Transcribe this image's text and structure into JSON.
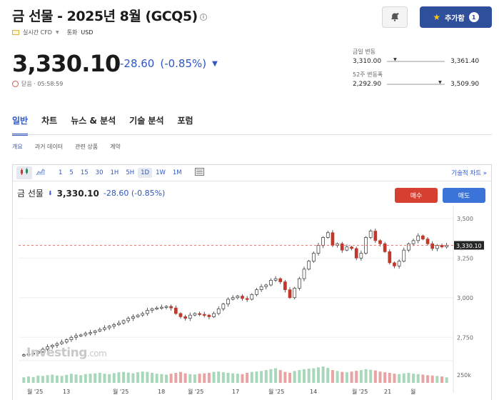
{
  "header": {
    "title": "금 선물 - 2025년 8월 (GCQ5)",
    "info_glyph": "i",
    "realtime_label": "실시간 CFD",
    "currency_label": "통화",
    "currency_value": "USD",
    "add_button_label": "추가함",
    "add_button_count": "1"
  },
  "quote": {
    "price": "3,330.10",
    "change": "-28.60",
    "change_pct": "(-0.85%)",
    "status": "닫음 · 05:58:59"
  },
  "ranges": {
    "daily_label": "금일 변동",
    "daily_low": "3,310.00",
    "daily_high": "3,361.40",
    "week52_label": "52주 변동폭",
    "week52_low": "2,292.90",
    "week52_high": "3,509.90"
  },
  "tabs": [
    "일반",
    "차트",
    "뉴스 & 분석",
    "기술 분석",
    "포럼"
  ],
  "subtabs": [
    "개요",
    "과거 데이터",
    "관련 상품",
    "계약"
  ],
  "toolbar": {
    "intervals": [
      "1",
      "5",
      "15",
      "30",
      "1H",
      "5H",
      "1D",
      "1W",
      "1M"
    ],
    "active": "1D",
    "tech_chart": "기술적 차트 »"
  },
  "chart_head": {
    "name": "금 선물",
    "price": "3,330.10",
    "change": "-28.60 (-0.85%)"
  },
  "buttons": {
    "buy": "매수",
    "sell": "매도"
  },
  "watermark": {
    "main": "Investing",
    "suffix": ".com"
  },
  "colors": {
    "accent": "#2f56c4",
    "up": "#2e8b57",
    "down": "#c0392b",
    "buy": "#d64030",
    "sell": "#3b74d9"
  },
  "chart_data": {
    "type": "candlestick",
    "y_axis_labels": [
      "3,500",
      "3,250",
      "3,000",
      "2,750"
    ],
    "y_axis_values": [
      3500,
      3250,
      3000,
      2750
    ],
    "ylim": [
      2625,
      3580
    ],
    "current_price_label": "3,330.10",
    "current_price": 3330.1,
    "volume_label": "250k",
    "x_axis_labels": [
      "월 '25",
      "13",
      "월 '25",
      "18",
      "월 '25",
      "17",
      "월 '25",
      "14",
      "월 '25",
      "21",
      "월"
    ],
    "grid": true,
    "closes": [
      2640,
      2645,
      2650,
      2660,
      2675,
      2690,
      2700,
      2710,
      2720,
      2735,
      2750,
      2760,
      2765,
      2775,
      2780,
      2790,
      2800,
      2810,
      2820,
      2830,
      2840,
      2855,
      2870,
      2880,
      2890,
      2900,
      2920,
      2930,
      2935,
      2940,
      2945,
      2935,
      2900,
      2880,
      2870,
      2890,
      2900,
      2895,
      2890,
      2880,
      2900,
      2930,
      2960,
      2990,
      3000,
      3010,
      2995,
      2990,
      3020,
      3050,
      3070,
      3080,
      3110,
      3120,
      3100,
      3050,
      3000,
      3060,
      3120,
      3180,
      3230,
      3280,
      3330,
      3380,
      3410,
      3330,
      3340,
      3300,
      3320,
      3310,
      3250,
      3280,
      3380,
      3420,
      3360,
      3340,
      3290,
      3220,
      3200,
      3230,
      3300,
      3340,
      3360,
      3390,
      3370,
      3340,
      3310,
      3330,
      3320,
      3330
    ],
    "volumes": [
      30,
      35,
      32,
      40,
      38,
      42,
      45,
      40,
      38,
      44,
      50,
      46,
      42,
      48,
      50,
      52,
      55,
      50,
      48,
      53,
      58,
      60,
      56,
      52,
      58,
      62,
      60,
      55,
      50,
      48,
      45,
      50,
      55,
      60,
      52,
      48,
      46,
      50,
      52,
      55,
      60,
      62,
      58,
      55,
      52,
      50,
      48,
      55,
      60,
      62,
      65,
      70,
      75,
      80,
      70,
      60,
      55,
      65,
      70,
      75,
      78,
      80,
      85,
      90,
      82,
      70,
      65,
      60,
      58,
      62,
      66,
      70,
      75,
      72,
      68,
      62,
      58,
      55,
      50,
      48,
      52,
      55,
      50,
      48,
      45,
      42,
      40,
      38,
      35,
      30
    ]
  }
}
